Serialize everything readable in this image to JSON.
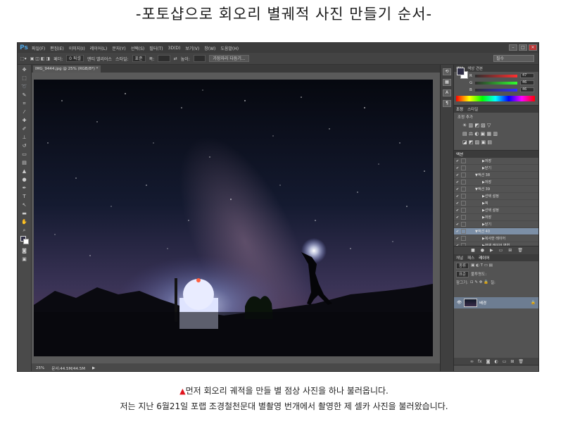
{
  "title": "-포토샵으로 회오리 별궤적 사진 만들기 순서-",
  "menu": {
    "logo": "Ps",
    "items": [
      "파일(F)",
      "편집(E)",
      "이미지(I)",
      "레이어(L)",
      "문자(Y)",
      "선택(S)",
      "필터(T)",
      "3D(D)",
      "보기(V)",
      "창(W)",
      "도움말(H)"
    ]
  },
  "options": {
    "feather_label": "페더:",
    "feather_value": "0 픽셀",
    "antialias": "앤티 앨리어스",
    "style_label": "스타일:",
    "style_value": "표준",
    "width_label": "폭:",
    "height_label": "높이:",
    "refine_edge": "가장자리 다듬기...",
    "workspace": "필수"
  },
  "document_tab": "IMG_9444.jpg @ 25% (RGB/8*) *",
  "status": {
    "zoom": "25%",
    "doc": "문서:44.5M/44.5M"
  },
  "color_panel": {
    "tabs": [
      "색상",
      "색상 견본"
    ],
    "r": "47",
    "g": "46",
    "b": "46"
  },
  "adjust_panel": {
    "tabs": [
      "조정",
      "스타일"
    ],
    "label": "조정 추가"
  },
  "actions_panel": {
    "tab": "액션",
    "rows": [
      {
        "label": "저장",
        "indent": 3,
        "selected": false
      },
      {
        "label": "닫기",
        "indent": 3,
        "selected": false
      },
      {
        "label": "액션 38",
        "indent": 2,
        "selected": false
      },
      {
        "label": "저장",
        "indent": 3,
        "selected": false
      },
      {
        "label": "액션 39",
        "indent": 2,
        "selected": false
      },
      {
        "label": "선택 설정",
        "indent": 3,
        "selected": false
      },
      {
        "label": "픽",
        "indent": 3,
        "selected": false
      },
      {
        "label": "선택 설정",
        "indent": 3,
        "selected": false
      },
      {
        "label": "저장",
        "indent": 3,
        "selected": false
      },
      {
        "label": "닫기",
        "indent": 3,
        "selected": false
      },
      {
        "label": "액션 40",
        "indent": 2,
        "selected": true
      },
      {
        "label": "복사한 레이어",
        "indent": 3,
        "selected": false
      },
      {
        "label": "현재 레이어 변형",
        "indent": 3,
        "selected": false
      },
      {
        "label": "현재 레이어 설정",
        "indent": 3,
        "selected": false
      }
    ]
  },
  "layers_panel": {
    "tabs": [
      "채널",
      "패스",
      "레이어"
    ],
    "kind": "종류",
    "blend": "표준",
    "opacity_label": "불투명도:",
    "lock_label": "잠그기:",
    "fill_label": "칠:",
    "layer_name": "배경"
  },
  "captions": {
    "line1": "먼저 회오리 궤적을 만들 별 점상 사진을 하나 불러옵니다.",
    "line2": "저는 지난 6월21일 포랩 조경철천문대 별촬영 번개에서 촬영한 제 셀카 사진을 불러왔습니다."
  }
}
